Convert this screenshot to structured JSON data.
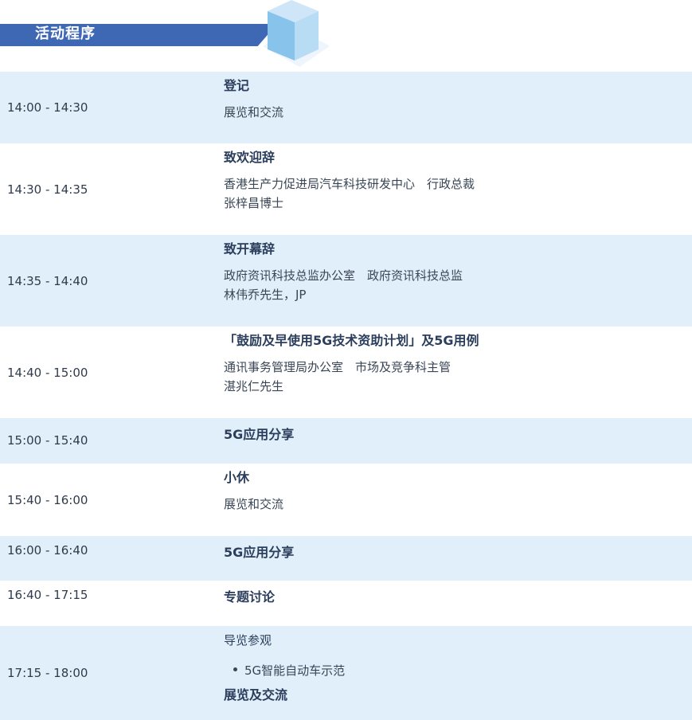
{
  "header": {
    "title": "活动程序"
  },
  "schedule": [
    {
      "time": "14:00 - 14:30",
      "title": "登记",
      "lines": [
        "展览和交流"
      ]
    },
    {
      "time": "14:30 - 14:35",
      "title": "致欢迎辞",
      "lines": [
        "香港生产力促进局汽车科技研发中心　行政总裁",
        "张梓昌博士"
      ]
    },
    {
      "time": "14:35 - 14:40",
      "title": "致开幕辞",
      "lines": [
        "政府资讯科技总监办公室　政府资讯科技总监",
        "林伟乔先生，JP"
      ]
    },
    {
      "time": "14:40 - 15:00",
      "title": "「鼓励及早使用5G技术资助计划」及5G用例",
      "lines": [
        "通讯事务管理局办公室　市场及竞争科主管",
        "湛兆仁先生"
      ]
    },
    {
      "time": "15:00 - 15:40",
      "title": "5G应用分享"
    },
    {
      "time": "15:40 - 16:00",
      "title": "小休",
      "lines": [
        "展览和交流"
      ]
    },
    {
      "time": "16:00 - 16:40",
      "title": "5G应用分享"
    },
    {
      "time": "16:40 - 17:15",
      "title": "专题讨论"
    },
    {
      "time": "17:15 - 18:00",
      "title": "导览参观",
      "bullet": "5G智能自动车示范",
      "footer": "展览及交流"
    }
  ]
}
